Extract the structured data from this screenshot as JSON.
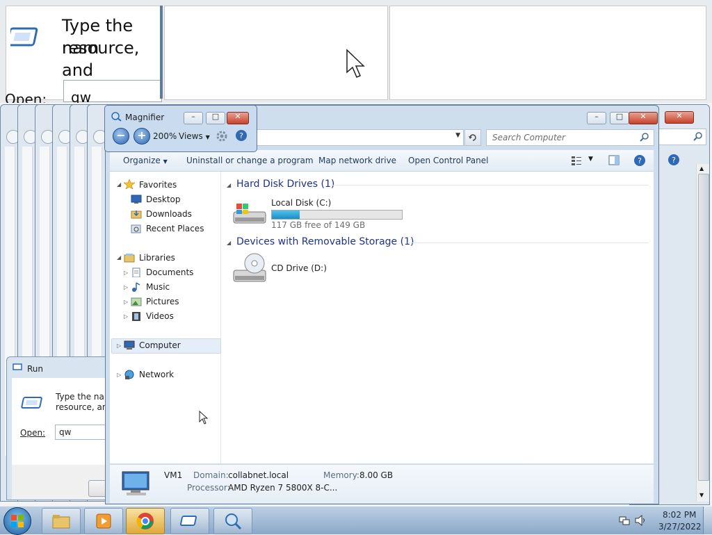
{
  "magnified_view": {
    "run_text_line1": "Type the nam",
    "run_text_line2": "resource, and",
    "open_label": "Open:",
    "open_value": "qw"
  },
  "magnifier": {
    "title": "Magnifier",
    "zoom_level": "200%",
    "views_label": "Views"
  },
  "explorer": {
    "search_placeholder": "Search Computer",
    "toolbar": {
      "organize": "Organize",
      "uninstall": "Uninstall or change a program",
      "map_drive": "Map network drive",
      "control_panel": "Open Control Panel"
    },
    "nav": {
      "favorites": "Favorites",
      "desktop": "Desktop",
      "downloads": "Downloads",
      "recent": "Recent Places",
      "libraries": "Libraries",
      "documents": "Documents",
      "music": "Music",
      "pictures": "Pictures",
      "videos": "Videos",
      "computer": "Computer",
      "network": "Network"
    },
    "content": {
      "hdd_header": "Hard Disk Drives (1)",
      "local_disk_name": "Local Disk (C:)",
      "local_disk_free": "117 GB free of 149 GB",
      "local_disk_used_fraction": 0.215,
      "removable_header": "Devices with Removable Storage (1)",
      "cd_drive_name": "CD Drive (D:)"
    },
    "details": {
      "computer_name": "VM1",
      "domain_label": "Domain:",
      "domain_value": "collabnet.local",
      "memory_label": "Memory:",
      "memory_value": "8.00 GB",
      "processor_label": "Processor:",
      "processor_value": "AMD Ryzen 7 5800X 8-C..."
    }
  },
  "run_dialog": {
    "title": "Run",
    "line1": "Type the nam",
    "line2": "resource, and",
    "open_label": "Open:",
    "open_value": "qw"
  },
  "taskbar": {
    "time": "8:02 PM",
    "date": "3/27/2022"
  },
  "colors": {
    "accent": "#1e3287",
    "progress": "#26a0da",
    "close_button": "#c7422c"
  }
}
